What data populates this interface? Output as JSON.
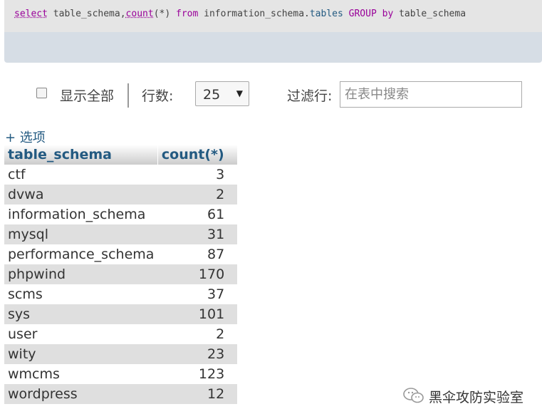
{
  "sql": {
    "kw_select": "select",
    "col1": " table_schema,",
    "kw_count": "count",
    "arg": "(*) ",
    "kw_from": "from",
    "schema": " information_schema.",
    "table": "tables",
    "kw_group": " GROUP",
    "kw_by": " by",
    "col2": " table_schema"
  },
  "controls": {
    "show_all_label": "显示全部",
    "rows_label": "行数:",
    "rows_value": "25",
    "filter_label": "过滤行:",
    "filter_placeholder": "在表中搜索"
  },
  "options_link": "+ 选项",
  "table": {
    "headers": [
      "table_schema",
      "count(*)"
    ],
    "rows": [
      {
        "schema": "ctf",
        "count": "3"
      },
      {
        "schema": "dvwa",
        "count": "2"
      },
      {
        "schema": "information_schema",
        "count": "61"
      },
      {
        "schema": "mysql",
        "count": "31"
      },
      {
        "schema": "performance_schema",
        "count": "87"
      },
      {
        "schema": "phpwind",
        "count": "170"
      },
      {
        "schema": "scms",
        "count": "37"
      },
      {
        "schema": "sys",
        "count": "101"
      },
      {
        "schema": "user",
        "count": "2"
      },
      {
        "schema": "wity",
        "count": "23"
      },
      {
        "schema": "wmcms",
        "count": "123"
      },
      {
        "schema": "wordpress",
        "count": "12"
      }
    ]
  },
  "watermark": {
    "icon": "wechat-icon",
    "text": "黑伞攻防实验室"
  },
  "colors": {
    "sql_keyword": "#990099",
    "link": "#235a81",
    "row_alt": "#dfdfdf"
  }
}
